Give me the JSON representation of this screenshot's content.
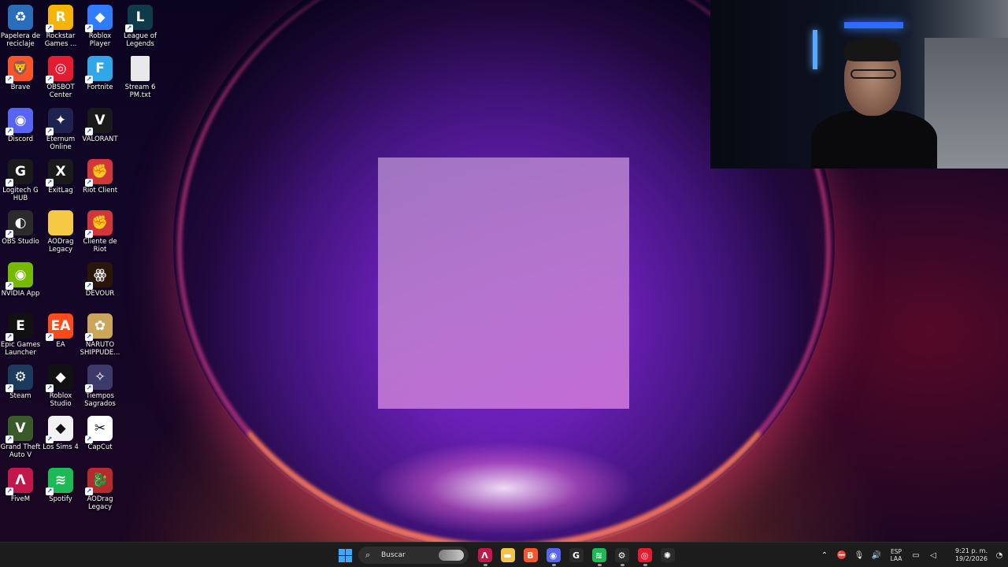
{
  "desktop_icons": [
    {
      "label": "Papelera de reciclaje",
      "icon": "recycle-bin-icon",
      "color": "#2a6db8",
      "glyph": "♻"
    },
    {
      "label": "Rockstar Games ...",
      "icon": "rockstar-icon",
      "color": "#f5b400",
      "glyph": "R"
    },
    {
      "label": "Roblox Player",
      "icon": "roblox-player-icon",
      "color": "#2f7cff",
      "glyph": "◆"
    },
    {
      "label": "League of Legends",
      "icon": "league-of-legends-icon",
      "color": "#0e3a4a",
      "glyph": "L"
    },
    {
      "label": "Brave",
      "icon": "brave-icon",
      "color": "#fb542b",
      "glyph": "🦁"
    },
    {
      "label": "OBSBOT Center",
      "icon": "obsbot-icon",
      "color": "#e51c2f",
      "glyph": "◎"
    },
    {
      "label": "Fortnite",
      "icon": "fortnite-icon",
      "color": "#2fa7e8",
      "glyph": "F"
    },
    {
      "label": "Stream 6 PM.txt",
      "icon": "text-file-icon",
      "color": "#e9e9e9",
      "glyph": ""
    },
    {
      "label": "Discord",
      "icon": "discord-icon",
      "color": "#5865f2",
      "glyph": "◉"
    },
    {
      "label": "Eternum Online",
      "icon": "eternum-online-icon",
      "color": "#1d2250",
      "glyph": "✦"
    },
    {
      "label": "VALORANT",
      "icon": "valorant-icon",
      "color": "#1a1a1a",
      "glyph": "V"
    },
    {
      "label": "Logitech G HUB",
      "icon": "logitech-ghub-icon",
      "color": "#1a1a1a",
      "glyph": "G"
    },
    {
      "label": "ExitLag",
      "icon": "exitlag-icon",
      "color": "#1a1a1a",
      "glyph": "X"
    },
    {
      "label": "Riot Client",
      "icon": "riot-client-icon",
      "color": "#d13639",
      "glyph": "✊"
    },
    {
      "label": "OBS Studio",
      "icon": "obs-studio-icon",
      "color": "#2b2b2b",
      "glyph": "◐"
    },
    {
      "label": "AODrag Legacy",
      "icon": "folder-icon",
      "color": "#f6c945",
      "glyph": ""
    },
    {
      "label": "Cliente de Riot",
      "icon": "riot-client-icon",
      "color": "#d13639",
      "glyph": "✊"
    },
    {
      "label": "NVIDIA App",
      "icon": "nvidia-icon",
      "color": "#76b900",
      "glyph": "◉"
    },
    {
      "label": "DEVOUR",
      "icon": "devour-icon",
      "color": "#2a1608",
      "glyph": "ꙮ"
    },
    {
      "label": "Epic Games Launcher",
      "icon": "epic-games-icon",
      "color": "#111111",
      "glyph": "E"
    },
    {
      "label": "EA",
      "icon": "ea-icon",
      "color": "#ff4a1c",
      "glyph": "EA"
    },
    {
      "label": "NARUTO SHIPPUDE...",
      "icon": "naruto-icon",
      "color": "#caa55a",
      "glyph": "✿"
    },
    {
      "label": "Steam",
      "icon": "steam-icon",
      "color": "#1b3a5c",
      "glyph": "⚙"
    },
    {
      "label": "Roblox Studio",
      "icon": "roblox-studio-icon",
      "color": "#111111",
      "glyph": "◆"
    },
    {
      "label": "Tiempos Sagrados",
      "icon": "tiempos-sagrados-icon",
      "color": "#3c3a6a",
      "glyph": "✧"
    },
    {
      "label": "Grand Theft Auto V",
      "icon": "gta-v-icon",
      "color": "#3a5a2a",
      "glyph": "V"
    },
    {
      "label": "Los Sims 4",
      "icon": "sims-4-icon",
      "color": "#f2f2f2",
      "glyph": "◆"
    },
    {
      "label": "CapCut",
      "icon": "capcut-icon",
      "color": "#ffffff",
      "glyph": "✂"
    },
    {
      "label": "FiveM",
      "icon": "fivem-icon",
      "color": "#c2174a",
      "glyph": "Λ"
    },
    {
      "label": "Spotify",
      "icon": "spotify-icon",
      "color": "#1db954",
      "glyph": "≋"
    },
    {
      "label": "AODrag Legacy",
      "icon": "aodrag-legacy-icon",
      "color": "#b52a2a",
      "glyph": "🐉"
    }
  ],
  "taskbar": {
    "search_placeholder": "Buscar",
    "apps": [
      {
        "name": "fivem-taskbar-icon",
        "color": "#c2174a",
        "glyph": "Λ",
        "running": true
      },
      {
        "name": "file-explorer-taskbar-icon",
        "color": "#f2c44a",
        "glyph": "▬",
        "running": false
      },
      {
        "name": "brave-taskbar-icon",
        "color": "#fb542b",
        "glyph": "B",
        "running": false
      },
      {
        "name": "discord-taskbar-icon",
        "color": "#5865f2",
        "glyph": "◉",
        "running": true
      },
      {
        "name": "logitech-ghub-taskbar-icon",
        "color": "#2a2a2a",
        "glyph": "G",
        "running": false
      },
      {
        "name": "spotify-taskbar-icon",
        "color": "#1db954",
        "glyph": "≋",
        "running": true
      },
      {
        "name": "steam-taskbar-icon",
        "color": "#2a2a2a",
        "glyph": "⚙",
        "running": true
      },
      {
        "name": "obsbot-taskbar-icon",
        "color": "#e51c2f",
        "glyph": "◎",
        "running": true
      },
      {
        "name": "settings-taskbar-icon",
        "color": "#2a2a2a",
        "glyph": "✺",
        "running": false
      }
    ],
    "tray": {
      "language_line1": "ESP",
      "language_line2": "LAA",
      "time": "9:21 p. m.",
      "date": "19/2/2026"
    }
  }
}
